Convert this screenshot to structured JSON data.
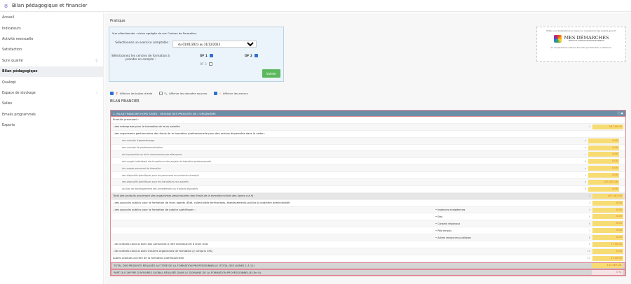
{
  "header": {
    "title": "Bilan pédagogique et financier",
    "logo_icon": "owl-icon"
  },
  "sidebar": {
    "items": [
      {
        "label": "Accueil",
        "badge": ""
      },
      {
        "label": "Indicateurs",
        "badge": ""
      },
      {
        "label": "Activité mensuelle",
        "badge": ""
      },
      {
        "label": "Satisfaction",
        "badge": ""
      },
      {
        "label": "Suivi qualité",
        "badge": "◊"
      },
      {
        "label": "Bilan pédagogique",
        "badge": "",
        "active": true
      },
      {
        "label": "Qualiopi",
        "badge": ""
      },
      {
        "label": "Espace de stockage",
        "badge": "›"
      },
      {
        "label": "Salles",
        "badge": ""
      },
      {
        "label": "Emails programmés",
        "badge": ""
      },
      {
        "label": "Exports",
        "badge": ""
      }
    ]
  },
  "pratique": {
    "title": "Pratique",
    "intro": "Vue sélectionnée : vision agrégée de vos Centres de Formation.",
    "exercice_label": "Sélectionnez un exercice comptable :",
    "exercice_value": "du 01/01/2023 au 31/12/2023",
    "centres_label": "Sélectionnez les centres de formation à prendre en compte :",
    "of1": "OF 1",
    "of2": "OF 2",
    "of3": "OF 3",
    "validate": "Valider"
  },
  "promo": {
    "top": "Faites vos déclarations en ligne sur mesdemarches.emploi.gouv.fr",
    "brand": "MES DÉMARCHES",
    "brand_sub": "EMPLOI ET FORMATION PROFESSIONNELLE",
    "bottom": "en recopiant les valeurs données par Dendreo ci-dessous."
  },
  "options": {
    "help": "Afficher les bulles d'aide",
    "sources": "Afficher les données sources",
    "errors": "Afficher les erreurs"
  },
  "section": "BILAN FINANCIER",
  "table": {
    "title": "C. BILAN FINANCIER HORS TAXES : ORIGINE DES PRODUITS DE L'ORGANISME",
    "rows": [
      {
        "label": "Produits provenant :",
        "num": "",
        "value": ""
      },
      {
        "label": "- des entreprises pour la formation de leurs salariés",
        "num": "1",
        "value": "16 200.00"
      },
      {
        "label": "- des organismes gestionnaires des fonds de la formation professionnelle pour des actions dispensées dans le cadre :",
        "num": "",
        "value": ""
      },
      {
        "label": "des contrats d'apprentissage",
        "num": "a",
        "value": "0.00",
        "type": "sub"
      },
      {
        "label": "des contrats de professionnalisation",
        "num": "b",
        "value": "0.00",
        "type": "sub"
      },
      {
        "label": "de la promotion ou de la reconversion par alternance",
        "num": "c",
        "value": "0.00",
        "type": "sub"
      },
      {
        "label": "des congés individuels de formation et des projets de transition professionnelle",
        "num": "d",
        "value": "0.00",
        "type": "sub"
      },
      {
        "label": "du compte personnel de formation",
        "num": "e",
        "value": "0.00",
        "type": "sub"
      },
      {
        "label": "des dispositifs spécifiques pour les personnes en recherche d'emploi",
        "num": "f",
        "value": "0.00",
        "type": "sub"
      },
      {
        "label": "des dispositifs spécifiques pour les travailleurs non-salariés",
        "num": "g",
        "value": "107 087.08",
        "type": "sub"
      },
      {
        "label": "du plan de développement des compétences ou d'autres dispositifs",
        "num": "h",
        "value": "0.00",
        "type": "sub"
      },
      {
        "label": "Total des produits provenant des organismes gestionnaires des fonds de la formation (total des lignes a à h)",
        "num": "2",
        "value": "107 087.08",
        "type": "tot"
      },
      {
        "label": "- des pouvoirs publics pour la formation de leurs agents (Etat, collectivités territoriales, établissements publics à caractère administratif)",
        "num": "3",
        "value": "0.00"
      },
      {
        "label": "- des pouvoirs publics pour la formation de publics spécifiques :",
        "mid": "• Instances européennes",
        "num": "4",
        "value": "0.00"
      },
      {
        "label": "",
        "mid": "• Etat",
        "num": "5",
        "value": "0.00"
      },
      {
        "label": "",
        "mid": "• Conseils régionaux",
        "num": "6",
        "value": "0.00"
      },
      {
        "label": "",
        "mid": "• Pôle emploi",
        "num": "7",
        "value": "0.00"
      },
      {
        "label": "",
        "mid": "• Autres ressources publiques",
        "num": "8",
        "value": "0.00"
      },
      {
        "label": "- de contrats conclus avec des personnes à titre individuel et à leurs frais",
        "num": "9",
        "value": "7 740.00"
      },
      {
        "label": "- de contrats conclus avec d'autres organismes de formation (y compris CFA)",
        "num": "10",
        "value": "0.00"
      },
      {
        "label": "Autres produits au titre de la formation professionnelle",
        "num": "11",
        "value": "1 100.00"
      },
      {
        "label": "TOTAL DES PRODUITS RÉALISÉS AU TITRE DE LA FORMATION PROFESSIONNELLE (TOTAL DES LIGNES 1 À 11)",
        "num": "",
        "value": "132 087.08",
        "type": "grand"
      },
      {
        "label": "PART DU CHIFFRE D'AFFAIRES GLOBAL RÉALISÉE DANS LE DOMAINE DE LA FORMATION PROFESSIONNELLE (En %)",
        "num": "",
        "value": "0 %",
        "type": "grand",
        "pct": true
      }
    ]
  },
  "colors": {
    "header_bar": "#6b8ea8",
    "value_bg": "#f7dc74",
    "value_text": "#d9741c",
    "border": "#e08a92",
    "validate": "#5cb85c"
  }
}
